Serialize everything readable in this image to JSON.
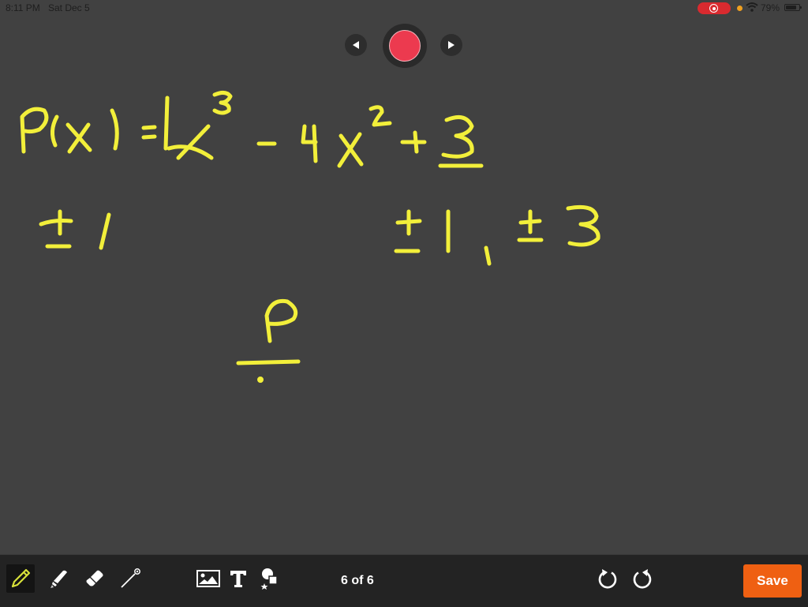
{
  "status_bar": {
    "time": "8:11 PM",
    "date": "Sat Dec 5",
    "battery_percent": "79%",
    "icons": [
      "screen-recording-icon",
      "orange-dot-indicator",
      "wifi-icon",
      "battery-icon"
    ]
  },
  "playback": {
    "prev_icon": "triangle-left-icon",
    "record_icon": "record-icon",
    "next_icon": "triangle-right-icon"
  },
  "canvas": {
    "ink_color": "#f2ef3a",
    "background_color": "#414141",
    "handwriting": {
      "line1": "P(x) = 1x^3 - 4x^2 + 3",
      "line2_left": "±1",
      "line2_right": "±1, ±3",
      "line3": "p / ."
    }
  },
  "toolbar": {
    "tools": [
      {
        "name": "pen",
        "icon": "pencil-icon",
        "active": true
      },
      {
        "name": "highlighter",
        "icon": "highlighter-icon",
        "active": false
      },
      {
        "name": "eraser",
        "icon": "eraser-icon",
        "active": false
      },
      {
        "name": "laser-pointer",
        "icon": "laser-pointer-icon",
        "active": false
      },
      {
        "name": "insert-image",
        "icon": "image-icon",
        "active": false
      },
      {
        "name": "text",
        "icon": "text-icon",
        "active": false
      },
      {
        "name": "shapes",
        "icon": "shapes-icon",
        "active": false
      }
    ],
    "page_indicator": "6 of 6",
    "undo_icon": "undo-icon",
    "redo_icon": "redo-icon",
    "save_label": "Save",
    "accent_color": "#ef6012",
    "active_tool_color": "#d8e23a"
  }
}
